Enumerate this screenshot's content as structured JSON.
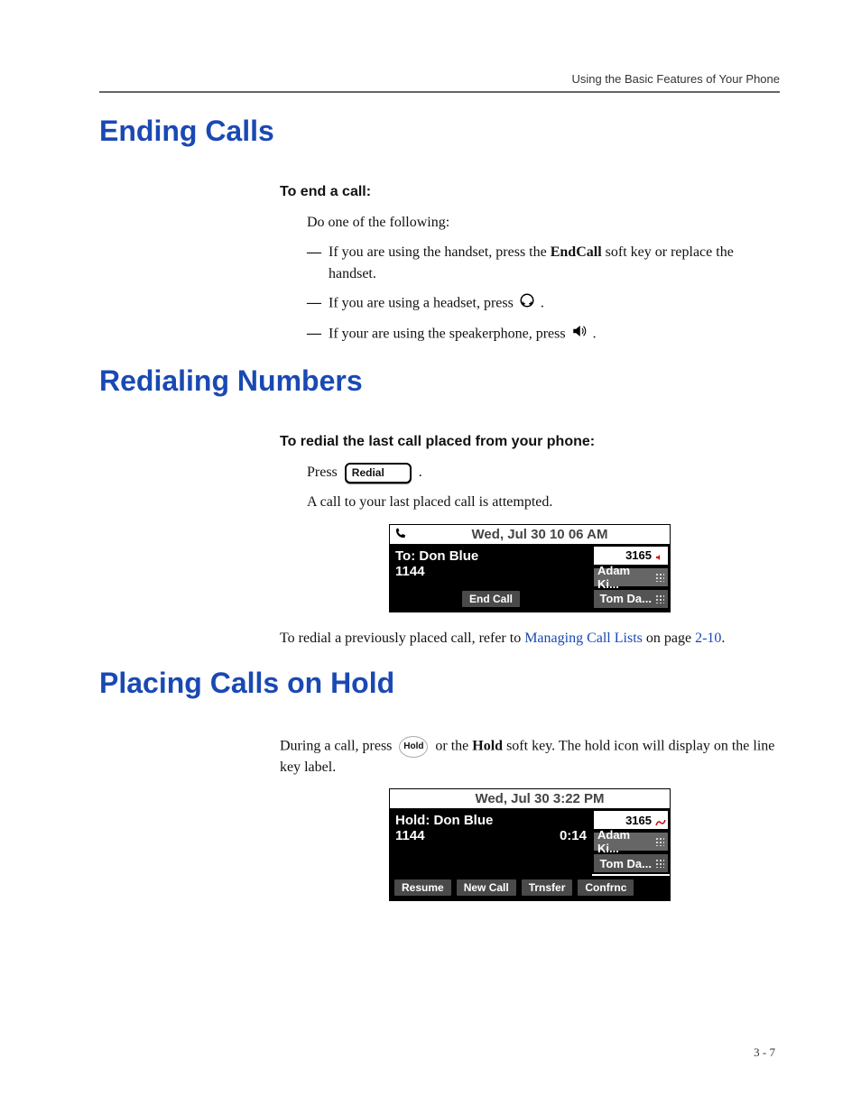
{
  "running_head": "Using the Basic Features of Your Phone",
  "page_number": "3 - 7",
  "s1": {
    "title": "Ending Calls",
    "lead": "To end a call:",
    "intro": "Do one of the following:",
    "b1_pre": "If you are using the handset, press the ",
    "b1_bold": "EndCall",
    "b1_post": " soft key or replace the handset.",
    "b2_pre": "If you are using a headset, press ",
    "b2_post": " .",
    "b3_pre": "If your are using the speakerphone, press ",
    "b3_post": " ."
  },
  "s2": {
    "title": "Redialing Numbers",
    "lead": "To redial the last call placed from your phone:",
    "press_pre": "Press ",
    "press_post": " .",
    "redial_key": "Redial",
    "after": "A call to your last placed call is attempted.",
    "ref_pre": "To redial a previously placed call, refer to ",
    "ref_link": "Managing Call Lists",
    "ref_mid": " on page ",
    "ref_page": "2-10",
    "ref_post": "."
  },
  "phone1": {
    "title": "Wed, Jul 30   10 06 AM",
    "line1": "To: Don Blue",
    "line2_left": "1144",
    "ext": "3165",
    "side2": "Adam Ki...",
    "side3": "Tom Da...",
    "soft1": "End Call"
  },
  "s3": {
    "title": "Placing Calls on Hold",
    "p_pre": "During a call, press ",
    "hold_key": "Hold",
    "p_mid": " or the ",
    "p_bold": "Hold",
    "p_post": " soft key. The hold icon will display on the line key label."
  },
  "phone2": {
    "title": "Wed, Jul 30   3:22 PM",
    "line1": "Hold: Don Blue",
    "line2_left": "1144",
    "line2_right": "0:14",
    "ext": "3165",
    "side2": "Adam Ki...",
    "side3": "Tom Da...",
    "soft1": "Resume",
    "soft2": "New Call",
    "soft3": "Trnsfer",
    "soft4": "Confrnc"
  }
}
